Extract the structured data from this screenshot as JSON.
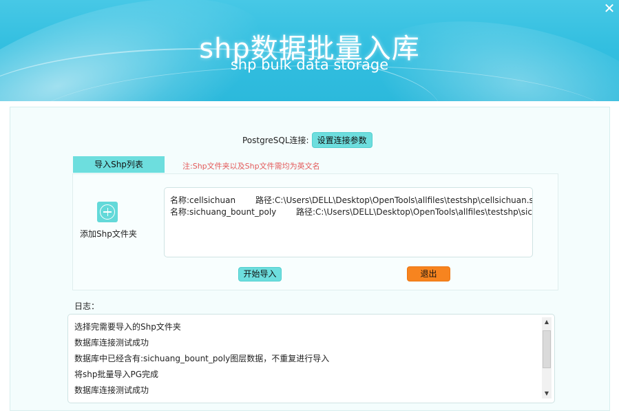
{
  "window": {
    "title": "shp数据批量入库",
    "subtitle": "shp bulk data storage",
    "close_glyph": "✕"
  },
  "connection": {
    "label": "PostgreSQL连接:",
    "button": "设置连接参数"
  },
  "import": {
    "tab_label": "导入Shp列表",
    "note": "注:Shp文件夹以及Shp文件需均为英文名",
    "add_folder_label": "添加Shp文件夹",
    "add_icon": "plus-circle-icon",
    "files": [
      {
        "name": "名称:cellsichuan",
        "path": "路径:C:\\Users\\DELL\\Desktop\\OpenTools\\allfiles\\testshp\\cellsichuan.shp"
      },
      {
        "name": "名称:sichuang_bount_poly",
        "path": "路径:C:\\Users\\DELL\\Desktop\\OpenTools\\allfiles\\testshp\\sichuang_bount_poly.shp"
      }
    ],
    "start_button": "开始导入",
    "exit_button": "退出"
  },
  "log": {
    "label": "日志：",
    "lines": [
      "选择完需要导入的Shp文件夹",
      "数据库连接测试成功",
      "数据库中已经含有:sichuang_bount_poly图层数据，不重复进行导入",
      "将shp批量导入PG完成",
      "数据库连接测试成功"
    ]
  },
  "colors": {
    "banner": "#33bfe0",
    "accent": "#6ddede",
    "exit": "#f7841f",
    "note": "#e35a5a"
  }
}
